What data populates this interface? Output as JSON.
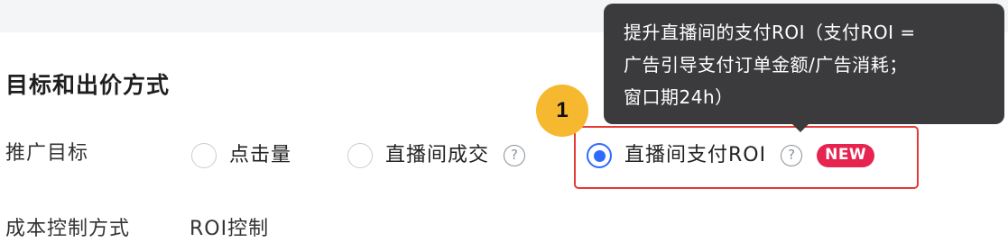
{
  "section": {
    "title": "目标和出价方式"
  },
  "goal": {
    "label": "推广目标",
    "options": [
      {
        "label": "点击量",
        "checked": false
      },
      {
        "label": "直播间成交",
        "checked": false,
        "help_icon": "question-circle-icon"
      },
      {
        "label": "直播间支付ROI",
        "checked": true,
        "help_icon": "question-circle-icon",
        "badge": "NEW"
      }
    ]
  },
  "cost_control": {
    "label": "成本控制方式",
    "value": "ROI控制"
  },
  "tooltip": {
    "lines": [
      "提升直播间的支付ROI（支付ROI =",
      "广告引导支付订单金额/广告消耗；",
      "窗口期24h）"
    ]
  },
  "step_marker": {
    "number": "1"
  },
  "colors": {
    "accent": "#2f6bff",
    "badge": "#e7234f",
    "highlight": "#e53935",
    "marker": "#f5b82e",
    "tooltip_bg": "#3b3b3d"
  }
}
